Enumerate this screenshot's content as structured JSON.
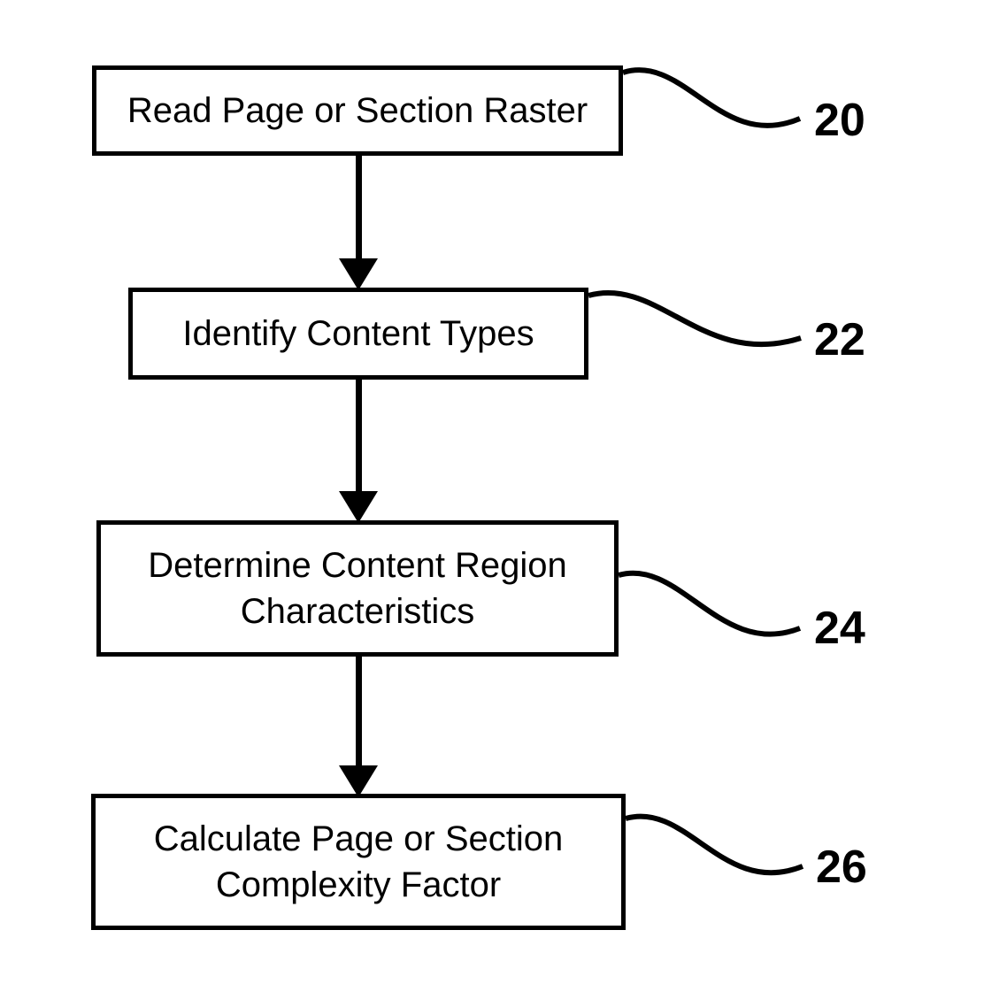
{
  "flowchart": {
    "steps": [
      {
        "id": "20",
        "text": "Read Page or Section Raster"
      },
      {
        "id": "22",
        "text": "Identify Content Types"
      },
      {
        "id": "24",
        "text": "Determine Content Region Characteristics"
      },
      {
        "id": "26",
        "text": "Calculate Page or Section Complexity Factor"
      }
    ]
  }
}
